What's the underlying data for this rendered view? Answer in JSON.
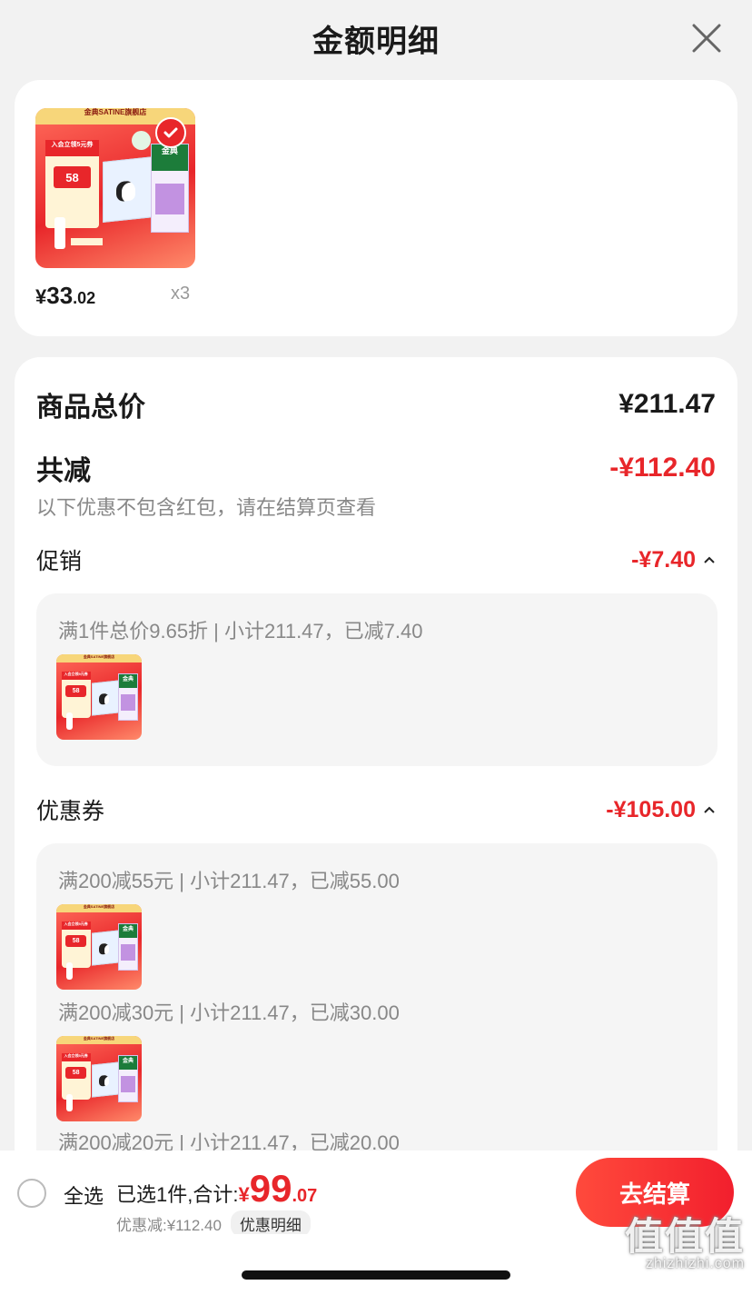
{
  "header": {
    "title": "金额明细"
  },
  "product": {
    "shop_banner": "金典SATINE旗舰店",
    "image_coupon_top": "入会立领5元券",
    "image_price": "58",
    "image_carton_brand": "金典",
    "price_symbol": "¥",
    "price_int": "33",
    "price_dec": ".02",
    "quantity": "x3",
    "selected": true
  },
  "summary": {
    "total_label": "商品总价",
    "total_value": "¥211.47",
    "reduce_label": "共减",
    "reduce_value": "-¥112.40",
    "note": "以下优惠不包含红包，请在结算页查看"
  },
  "promotion": {
    "label": "促销",
    "amount": "-¥7.40",
    "rule": "满1件总价9.65折 | 小计211.47，已减7.40"
  },
  "coupons": {
    "label": "优惠券",
    "amount": "-¥105.00",
    "rules": [
      "满200减55元 | 小计211.47，已减55.00",
      "满200减30元 | 小计211.47，已减30.00",
      "满200减20元 | 小计211.47，已减20.00"
    ]
  },
  "bottom_bar": {
    "select_all": "全选",
    "selected_text": "已选1件,合计:",
    "total_symbol": "¥",
    "total_int": "99",
    "total_dec": ".07",
    "discount_text": "优惠减:¥112.40",
    "detail_pill": "优惠明细",
    "checkout": "去结算"
  },
  "watermark": {
    "big": "值值值",
    "small": "zhizhizhi.com"
  },
  "colors": {
    "accent": "#e8262a",
    "muted": "#888888",
    "background": "#f2f2f2"
  },
  "icons": {
    "close": "close-icon",
    "check": "check-icon",
    "chevron": "chevron-up-icon"
  }
}
